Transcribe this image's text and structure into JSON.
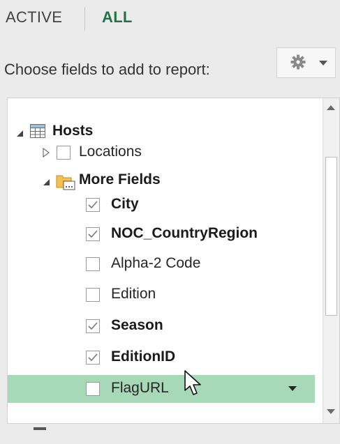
{
  "tabs": {
    "active": "ACTIVE",
    "all": "ALL"
  },
  "toolbar": {
    "choose_label": "Choose fields to add to report:",
    "settings_icon": "gear-icon"
  },
  "fields": {
    "table_name": "Hosts",
    "locations_label": "Locations",
    "group_name": "More Fields",
    "items": [
      {
        "label": "City",
        "checked": true,
        "bold": true
      },
      {
        "label": "NOC_CountryRegion",
        "checked": true,
        "bold": true
      },
      {
        "label": "Alpha-2 Code",
        "checked": false,
        "bold": false
      },
      {
        "label": "Edition",
        "checked": false,
        "bold": false
      },
      {
        "label": "Season",
        "checked": true,
        "bold": true
      },
      {
        "label": "EditionID",
        "checked": true,
        "bold": true
      },
      {
        "label": "FlagURL",
        "checked": false,
        "bold": false,
        "highlighted": true
      }
    ]
  },
  "colors": {
    "accent": "#217346",
    "highlight": "#a7d8b8",
    "panel_bg": "#ebebeb"
  }
}
